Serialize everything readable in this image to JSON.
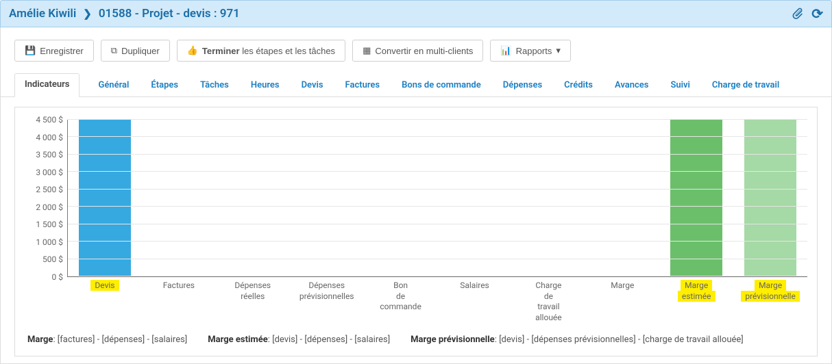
{
  "header": {
    "breadcrumb": [
      "Amélie Kiwili",
      "01588 - Projet - devis : 971"
    ]
  },
  "toolbar": {
    "save": "Enregistrer",
    "duplicate": "Dupliquer",
    "finish_bold": "Terminer",
    "finish_rest": " les étapes et les tâches",
    "convert": "Convertir en multi-clients",
    "reports": "Rapports"
  },
  "tabs": [
    {
      "label": "Indicateurs",
      "active": true
    },
    {
      "label": "Général"
    },
    {
      "label": "Étapes"
    },
    {
      "label": "Tâches"
    },
    {
      "label": "Heures"
    },
    {
      "label": "Devis"
    },
    {
      "label": "Factures"
    },
    {
      "label": "Bons de commande"
    },
    {
      "label": "Dépenses"
    },
    {
      "label": "Crédits"
    },
    {
      "label": "Avances"
    },
    {
      "label": "Suivi"
    },
    {
      "label": "Charge de travail"
    }
  ],
  "chart_data": {
    "type": "bar",
    "ylabel": "",
    "ylim": [
      0,
      4500
    ],
    "y_ticks": [
      "4 500 $",
      "4 000 $",
      "3 500 $",
      "3 000 $",
      "2 500 $",
      "2 000 $",
      "1 500 $",
      "1 000 $",
      "500 $",
      "0 $"
    ],
    "categories": [
      {
        "label": "Devis",
        "highlight": true
      },
      {
        "label": "Factures"
      },
      {
        "label": "Dépenses\nréelles"
      },
      {
        "label": "Dépenses\nprévisionnelles"
      },
      {
        "label": "Bon\nde\ncommande"
      },
      {
        "label": "Salaires"
      },
      {
        "label": "Charge\nde\ntravail\nallouée"
      },
      {
        "label": "Marge"
      },
      {
        "label": "Marge\nestimée",
        "highlight": true
      },
      {
        "label": "Marge\nprévisionnelle",
        "highlight": true
      }
    ],
    "values": [
      4500,
      0,
      0,
      0,
      0,
      0,
      0,
      0,
      4500,
      4500
    ],
    "colors": [
      "#36a9e1",
      "#36a9e1",
      "#36a9e1",
      "#36a9e1",
      "#36a9e1",
      "#36a9e1",
      "#36a9e1",
      "#36a9e1",
      "#6bbf6b",
      "#a5d9a5"
    ]
  },
  "legend": [
    {
      "title": "Marge",
      "formula": "[factures] - [dépenses] - [salaires]"
    },
    {
      "title": "Marge estimée",
      "formula": "[devis] - [dépenses] - [salaires]"
    },
    {
      "title": "Marge prévisionnelle",
      "formula": "[devis] - [dépenses prévisionnelles] - [charge de travail allouée]"
    }
  ]
}
